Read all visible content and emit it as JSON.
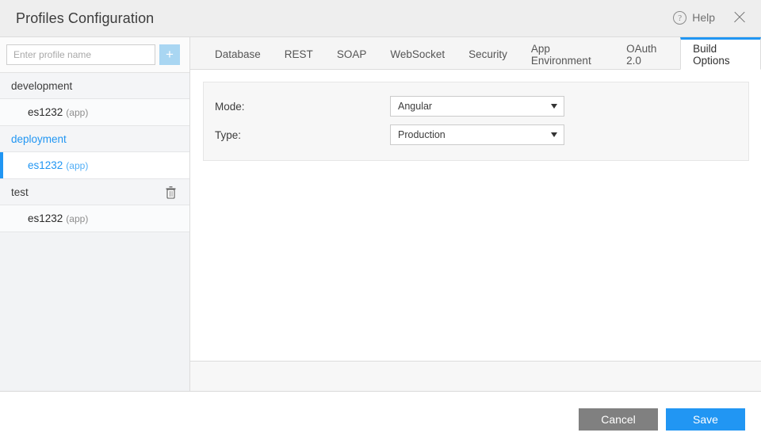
{
  "header": {
    "title": "Profiles Configuration",
    "help_label": "Help",
    "help_icon": "question-circle-icon",
    "close_icon": "close-icon"
  },
  "sidebar": {
    "input_placeholder": "Enter profile name",
    "input_value": "",
    "add_button_label": "+",
    "groups": [
      {
        "name": "development",
        "selected": false,
        "has_delete": false,
        "children": [
          {
            "name": "es1232",
            "suffix": "(app)",
            "selected": false
          }
        ]
      },
      {
        "name": "deployment",
        "selected": true,
        "has_delete": false,
        "children": [
          {
            "name": "es1232",
            "suffix": "(app)",
            "selected": true
          }
        ]
      },
      {
        "name": "test",
        "selected": false,
        "has_delete": true,
        "delete_icon": "trash-icon",
        "children": [
          {
            "name": "es1232",
            "suffix": "(app)",
            "selected": false
          }
        ]
      }
    ]
  },
  "tabs": [
    {
      "label": "Database",
      "active": false
    },
    {
      "label": "REST",
      "active": false
    },
    {
      "label": "SOAP",
      "active": false
    },
    {
      "label": "WebSocket",
      "active": false
    },
    {
      "label": "Security",
      "active": false
    },
    {
      "label": "App Environment",
      "active": false
    },
    {
      "label": "OAuth 2.0",
      "active": false
    },
    {
      "label": "Build Options",
      "active": true
    }
  ],
  "form": {
    "fields": [
      {
        "label": "Mode:",
        "value": "Angular"
      },
      {
        "label": "Type:",
        "value": "Production"
      }
    ]
  },
  "footer": {
    "cancel_label": "Cancel",
    "save_label": "Save"
  },
  "colors": {
    "accent": "#2196f3",
    "cancel": "#808080",
    "header_bg": "#eeeeee",
    "sidebar_bg": "#f2f3f5",
    "panel_bg": "#f7f7f7"
  }
}
